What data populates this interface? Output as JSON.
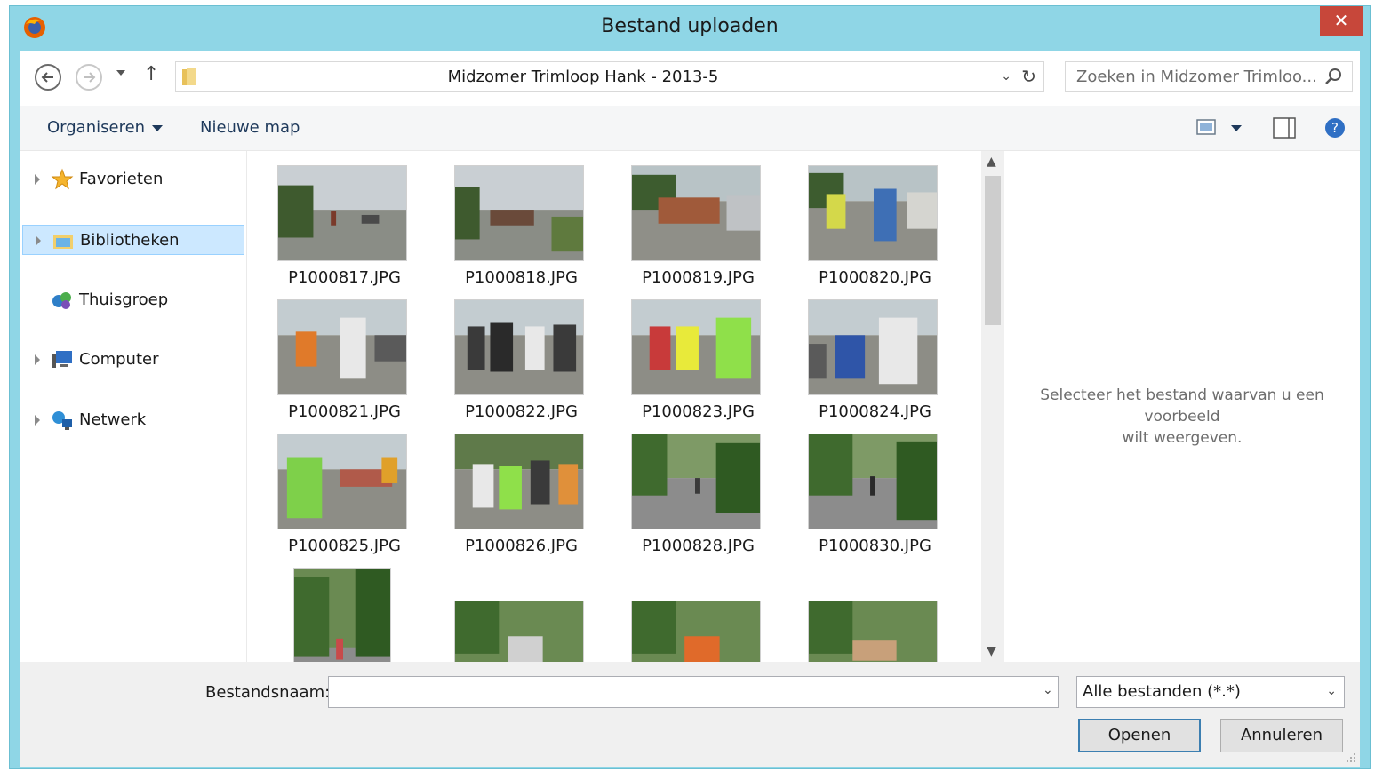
{
  "window": {
    "title": "Bestand uploaden",
    "close_glyph": "✕"
  },
  "address": {
    "path": "Midzomer Trimloop Hank - 2013-5",
    "search_placeholder": "Zoeken in Midzomer Trimloo..."
  },
  "toolbar": {
    "organize_label": "Organiseren",
    "new_folder_label": "Nieuwe map"
  },
  "nav": {
    "items": [
      {
        "label": "Favorieten",
        "icon": "star-icon"
      },
      {
        "label": "Bibliotheken",
        "icon": "libraries-icon",
        "selected": true
      },
      {
        "label": "Thuisgroep",
        "icon": "homegroup-icon"
      },
      {
        "label": "Computer",
        "icon": "computer-icon"
      },
      {
        "label": "Netwerk",
        "icon": "network-icon"
      }
    ]
  },
  "files": [
    {
      "name": "P1000817.JPG"
    },
    {
      "name": "P1000818.JPG"
    },
    {
      "name": "P1000819.JPG"
    },
    {
      "name": "P1000820.JPG"
    },
    {
      "name": "P1000821.JPG"
    },
    {
      "name": "P1000822.JPG"
    },
    {
      "name": "P1000823.JPG"
    },
    {
      "name": "P1000824.JPG"
    },
    {
      "name": "P1000825.JPG"
    },
    {
      "name": "P1000826.JPG"
    },
    {
      "name": "P1000828.JPG"
    },
    {
      "name": "P1000830.JPG"
    },
    {
      "name": ""
    },
    {
      "name": ""
    },
    {
      "name": ""
    },
    {
      "name": ""
    }
  ],
  "preview": {
    "message_line1": "Selecteer het bestand waarvan u een voorbeeld",
    "message_line2": "wilt weergeven."
  },
  "footer": {
    "filename_label": "Bestandsnaam:",
    "filename_value": "",
    "filetype_value": "Alle bestanden (*.*)",
    "open_label": "Openen",
    "cancel_label": "Annuleren"
  },
  "colors": {
    "titlebar": "#8fd6e6",
    "close": "#c7473a",
    "selection": "#cce8ff",
    "link_text": "#1e395b"
  }
}
